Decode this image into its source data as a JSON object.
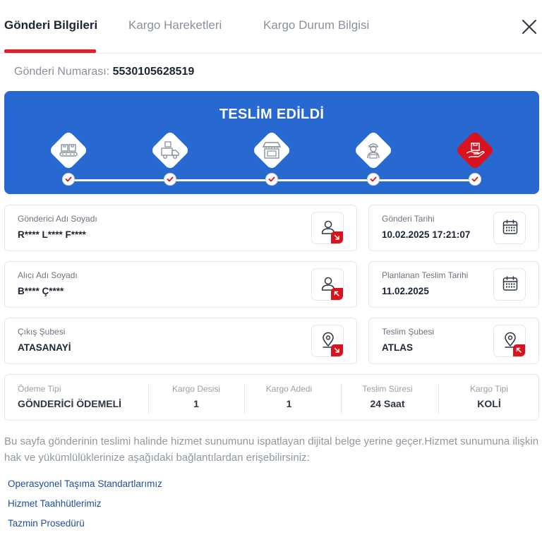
{
  "tabs": [
    {
      "label": "Gönderi Bilgileri",
      "active": true
    },
    {
      "label": "Kargo Hareketleri",
      "active": false
    },
    {
      "label": "Kargo Durum Bilgisi",
      "active": false
    }
  ],
  "shipment": {
    "number_label": "Gönderi Numarası:",
    "number": "5530105628519"
  },
  "status": {
    "title": "TESLİM EDİLDİ",
    "steps": [
      {
        "icon": "boxes-conveyor-icon",
        "completed": true
      },
      {
        "icon": "delivery-truck-icon",
        "completed": true
      },
      {
        "icon": "branch-store-icon",
        "completed": true
      },
      {
        "icon": "courier-icon",
        "completed": true
      },
      {
        "icon": "hand-package-icon",
        "completed": true,
        "current": true
      }
    ]
  },
  "cards": {
    "sender": {
      "label": "Gönderici Adı Soyadı",
      "value": "R**** L**** F****",
      "icon": "user-icon",
      "badge": "arrow-down-right-icon"
    },
    "sent_date": {
      "label": "Gönderi Tarihi",
      "value": "10.02.2025 17:21:07",
      "icon": "calendar-icon"
    },
    "receiver": {
      "label": "Alıcı Adı Soyadı",
      "value": "B**** Ç****",
      "icon": "user-icon",
      "badge": "arrow-up-left-icon"
    },
    "planned_date": {
      "label": "Planlanan Teslim Tarihi",
      "value": "11.02.2025",
      "icon": "calendar-icon"
    },
    "origin_branch": {
      "label": "Çıkış Şubesi",
      "value": "ATASANAYİ",
      "icon": "location-pin-icon",
      "badge": "arrow-down-right-icon"
    },
    "delivery_branch": {
      "label": "Teslim Şubesi",
      "value": "ATLAS",
      "icon": "location-pin-icon",
      "badge": "arrow-up-left-icon"
    }
  },
  "details": [
    {
      "label": "Ödeme Tipi",
      "value": "GÖNDERİCİ ÖDEMELİ"
    },
    {
      "label": "Kargo Desisi",
      "value": "1"
    },
    {
      "label": "Kargo Adedi",
      "value": "1"
    },
    {
      "label": "Teslim Süresi",
      "value": "24 Saat"
    },
    {
      "label": "Kargo Tipi",
      "value": "KOLİ"
    }
  ],
  "notice": "Bu sayfa gönderinin teslimi halinde hizmet sunumunu ispatlayan dijital belge yerine geçer.Hizmet sunumuna ilişkin hak ve yükümlülüklerinize aşağıdaki bağlantılardan erişebilirsiniz:",
  "links": [
    {
      "label": "Operasyonel Taşıma Standartlarımız"
    },
    {
      "label": "Hizmet Taahhütlerimiz"
    },
    {
      "label": "Tazmin Prosedürü"
    }
  ],
  "colors": {
    "brand_blue": "#2769d0",
    "accent_red": "#d9121d",
    "text_dark": "#1c2533",
    "link_blue": "#1f4e9c"
  }
}
